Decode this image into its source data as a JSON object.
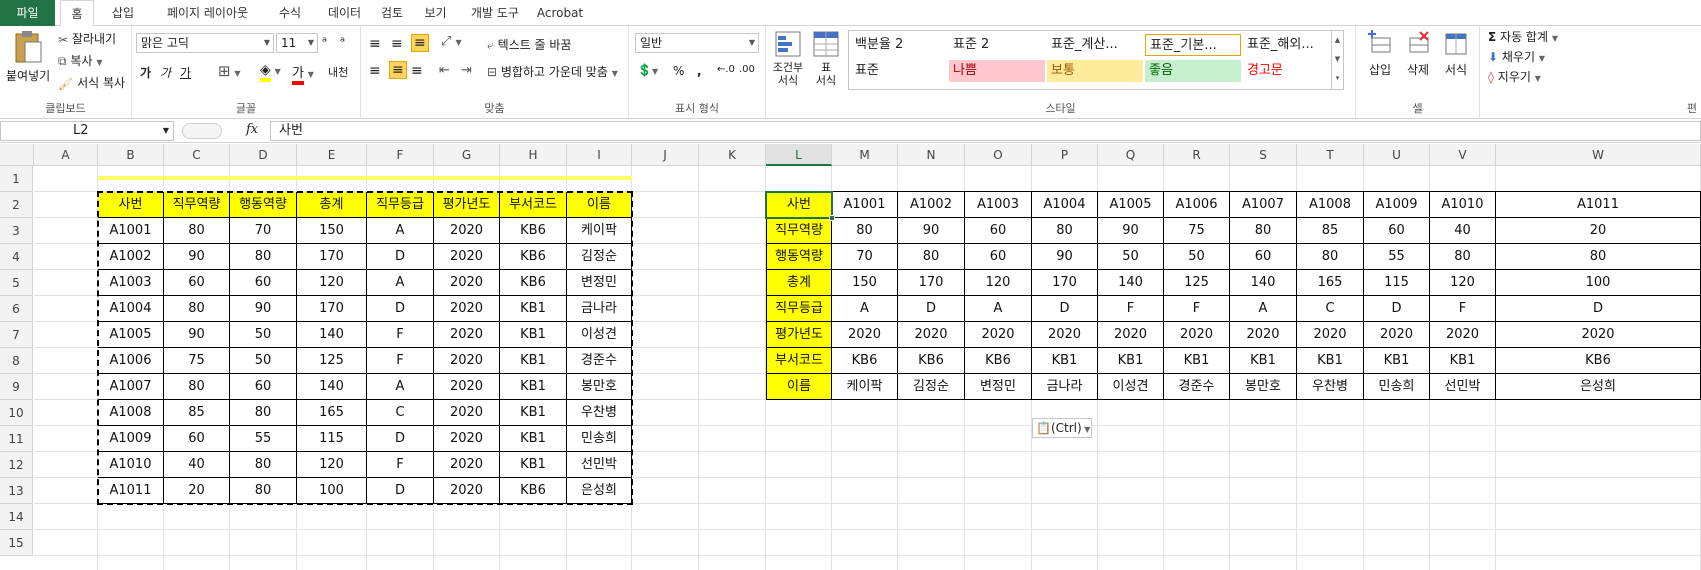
{
  "tabs": [
    "파일",
    "홈",
    "삽입",
    "페이지 레이아웃",
    "수식",
    "데이터",
    "검토",
    "보기",
    "개발 도구",
    "Acrobat"
  ],
  "active_tab": "홈",
  "ribbon": {
    "clipboard": {
      "paste": "붙여넣기",
      "cut": "잘라내기",
      "copy": "복사",
      "format_painter": "서식 복사",
      "label": "클립보드"
    },
    "font": {
      "name": "맑은 고딕",
      "size": "11",
      "bold": "가",
      "italic": "가",
      "underline": "가",
      "label": "글꼴",
      "strike": "내천"
    },
    "alignment": {
      "wrap": "텍스트 줄 바꿈",
      "merge": "병합하고 가운데 맞춤",
      "label": "맞춤"
    },
    "number": {
      "format": "일반",
      "percent": "%",
      "comma": ",",
      "label": "표시 형식"
    },
    "conditional": "조건부\n서식",
    "table_format": "표\n서식",
    "styles": {
      "label": "스타일",
      "row1": [
        "백분율 2",
        "표준 2",
        "표준_계산...",
        "표준_기본...",
        "표준_해외..."
      ],
      "row2": [
        "표준",
        "나쁨",
        "보통",
        "좋음",
        "경고문"
      ]
    },
    "cells": {
      "insert": "삽입",
      "delete": "삭제",
      "format": "서식",
      "label": "셀"
    },
    "editing": {
      "autosum": "자동 합계",
      "fill": "채우기",
      "clear": "지우기",
      "label": "편"
    }
  },
  "formula_bar": {
    "name_box": "L2",
    "fx": "fx",
    "content": "사번"
  },
  "columns": [
    "A",
    "B",
    "C",
    "D",
    "E",
    "F",
    "G",
    "H",
    "I",
    "J",
    "K",
    "L",
    "M",
    "N",
    "O",
    "P",
    "Q",
    "R",
    "S",
    "T",
    "U",
    "V",
    "W"
  ],
  "rows": [
    "1",
    "2",
    "3",
    "4",
    "5",
    "6",
    "7",
    "8",
    "9",
    "10",
    "11",
    "12",
    "13",
    "14",
    "15"
  ],
  "selected_column": "L",
  "table1": {
    "headers": [
      "사번",
      "직무역량",
      "행동역량",
      "총계",
      "직무등급",
      "평가년도",
      "부서코드",
      "이름"
    ],
    "rows": [
      [
        "A1001",
        "80",
        "70",
        "150",
        "A",
        "2020",
        "KB6",
        "케이팍"
      ],
      [
        "A1002",
        "90",
        "80",
        "170",
        "D",
        "2020",
        "KB6",
        "김정순"
      ],
      [
        "A1003",
        "60",
        "60",
        "120",
        "A",
        "2020",
        "KB6",
        "변정민"
      ],
      [
        "A1004",
        "80",
        "90",
        "170",
        "D",
        "2020",
        "KB1",
        "금나라"
      ],
      [
        "A1005",
        "90",
        "50",
        "140",
        "F",
        "2020",
        "KB1",
        "이성견"
      ],
      [
        "A1006",
        "75",
        "50",
        "125",
        "F",
        "2020",
        "KB1",
        "경준수"
      ],
      [
        "A1007",
        "80",
        "60",
        "140",
        "A",
        "2020",
        "KB1",
        "봉만호"
      ],
      [
        "A1008",
        "85",
        "80",
        "165",
        "C",
        "2020",
        "KB1",
        "우찬병"
      ],
      [
        "A1009",
        "60",
        "55",
        "115",
        "D",
        "2020",
        "KB1",
        "민송희"
      ],
      [
        "A1010",
        "40",
        "80",
        "120",
        "F",
        "2020",
        "KB1",
        "선민박"
      ],
      [
        "A1011",
        "20",
        "80",
        "100",
        "D",
        "2020",
        "KB6",
        "은성희"
      ]
    ]
  },
  "table2": {
    "row_headers": [
      "사번",
      "직무역량",
      "행동역량",
      "총계",
      "직무등급",
      "평가년도",
      "부서코드",
      "이름"
    ],
    "columns": [
      [
        "A1001",
        "80",
        "70",
        "150",
        "A",
        "2020",
        "KB6",
        "케이팍"
      ],
      [
        "A1002",
        "90",
        "80",
        "170",
        "D",
        "2020",
        "KB6",
        "김정순"
      ],
      [
        "A1003",
        "60",
        "60",
        "120",
        "A",
        "2020",
        "KB6",
        "변정민"
      ],
      [
        "A1004",
        "80",
        "90",
        "170",
        "D",
        "2020",
        "KB1",
        "금나라"
      ],
      [
        "A1005",
        "90",
        "50",
        "140",
        "F",
        "2020",
        "KB1",
        "이성견"
      ],
      [
        "A1006",
        "75",
        "50",
        "125",
        "F",
        "2020",
        "KB1",
        "경준수"
      ],
      [
        "A1007",
        "80",
        "60",
        "140",
        "A",
        "2020",
        "KB1",
        "봉만호"
      ],
      [
        "A1008",
        "85",
        "80",
        "165",
        "C",
        "2020",
        "KB1",
        "우찬병"
      ],
      [
        "A1009",
        "60",
        "55",
        "115",
        "D",
        "2020",
        "KB1",
        "민송희"
      ],
      [
        "A1010",
        "40",
        "80",
        "120",
        "F",
        "2020",
        "KB1",
        "선민박"
      ],
      [
        "A1011",
        "20",
        "80",
        "100",
        "D",
        "2020",
        "KB6",
        "은성희"
      ]
    ]
  },
  "paste_options": "(Ctrl)",
  "colors": {
    "excel_green": "#217346",
    "header_yellow": "#ffff00",
    "bad_bg": "#ffc7ce",
    "bad_fg": "#9c0006",
    "neutral_bg": "#ffeb9c",
    "neutral_fg": "#9c5700",
    "good_bg": "#c6efce",
    "good_fg": "#006100",
    "warn_fg": "#ff0000"
  }
}
